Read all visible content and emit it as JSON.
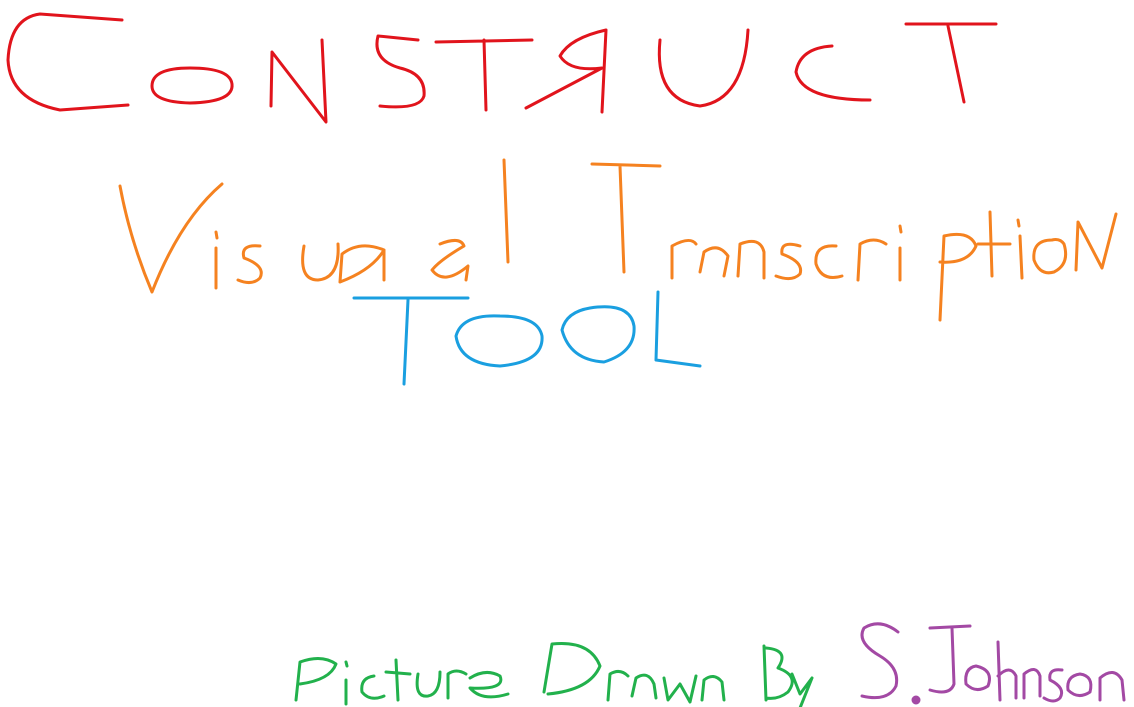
{
  "drawing": {
    "title": "CONSTRUCT",
    "subtitle": "Visual Transcription",
    "subtitle2": "TOOL",
    "credit": "Picture Drawn By",
    "author": "S. Johnson",
    "colors": {
      "title": "#e1141c",
      "subtitle": "#f58220",
      "subtitle2": "#1a9fe0",
      "credit": "#22b14c",
      "author": "#a349a4",
      "background": "#ffffff"
    }
  }
}
